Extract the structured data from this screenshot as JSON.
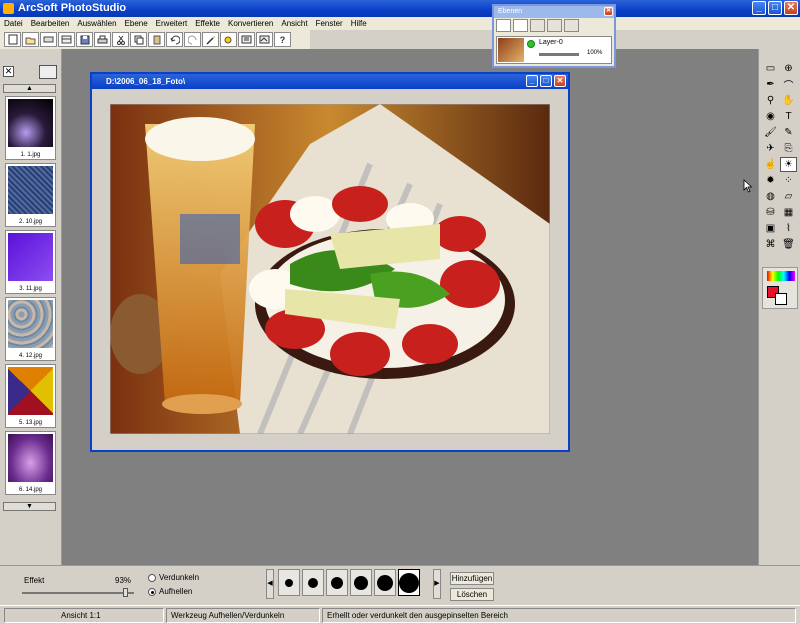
{
  "app": {
    "title": "ArcSoft PhotoStudio"
  },
  "menu": [
    "Datei",
    "Bearbeiten",
    "Auswählen",
    "Ebene",
    "Erweitert",
    "Effekte",
    "Konvertieren",
    "Ansicht",
    "Fenster",
    "Hilfe"
  ],
  "toolbar": {
    "icons": [
      "new-file-icon",
      "open-icon",
      "scan-icon",
      "acquire-icon",
      "save-icon",
      "print-icon",
      "cut-icon",
      "copy-icon",
      "paste-icon",
      "undo-icon",
      "redo-icon",
      "wand-icon",
      "layer-icon",
      "crop-icon",
      "resize-icon",
      "help-icon"
    ],
    "help_glyph": "?"
  },
  "album": {
    "thumbnails": [
      {
        "caption": "1. 1.jpg",
        "colors": [
          "#2a1a3a",
          "#b59cf0"
        ]
      },
      {
        "caption": "2. 10.jpg",
        "colors": [
          "#2b3f6e",
          "#4f6aa4"
        ]
      },
      {
        "caption": "3. 11.jpg",
        "colors": [
          "#5a12d8",
          "#8d4df2"
        ]
      },
      {
        "caption": "4. 12.jpg",
        "colors": [
          "#8b9cb5",
          "#c8b8a8"
        ]
      },
      {
        "caption": "5. 13.jpg",
        "colors": [
          "#e0c000",
          "#a01020"
        ]
      },
      {
        "caption": "6. 14.jpg",
        "colors": [
          "#6b2d8f",
          "#d6a0e8"
        ]
      }
    ]
  },
  "document": {
    "title": "D:\\2006_06_18_Foto\\",
    "image_alt": "Beer glass with tomato and mozzarella plate"
  },
  "layers": {
    "title": "Ebenen",
    "layer_name": "Layer-0",
    "opacity": "100%"
  },
  "tools": {
    "icons": [
      "marquee-icon",
      "crosshair-icon",
      "pen-icon",
      "lasso-icon",
      "zoom-icon",
      "hand-icon",
      "eye-icon",
      "text-icon",
      "brush-icon",
      "pencil-icon",
      "airbrush-icon",
      "clone-icon",
      "smudge-icon",
      "dodge-icon",
      "burn-icon",
      "spray-icon",
      "sponge-icon",
      "eraser-icon",
      "bucket-icon",
      "gradient-icon",
      "stamp-icon",
      "eyedropper-icon",
      "warp-icon",
      "trash-icon"
    ],
    "text_glyph": "T",
    "foreground_color": "#e8102a",
    "background_color": "#ffffff"
  },
  "options": {
    "effect_label": "Effekt",
    "effect_value": "93%",
    "effect_level": 0.93,
    "radio_darken": "Verdunkeln",
    "radio_lighten": "Aufhellen",
    "selected_radio": "Aufhellen",
    "add_button": "Hinzufügen",
    "delete_button": "Löschen",
    "brush_sizes": [
      8,
      10,
      12,
      14,
      16,
      20
    ]
  },
  "status": {
    "view": "Ansicht 1:1",
    "tool": "Werkzeug Aufhellen/Verdunkeln",
    "hint": "Erhellt oder verdunkelt den ausgepinselten Bereich"
  }
}
